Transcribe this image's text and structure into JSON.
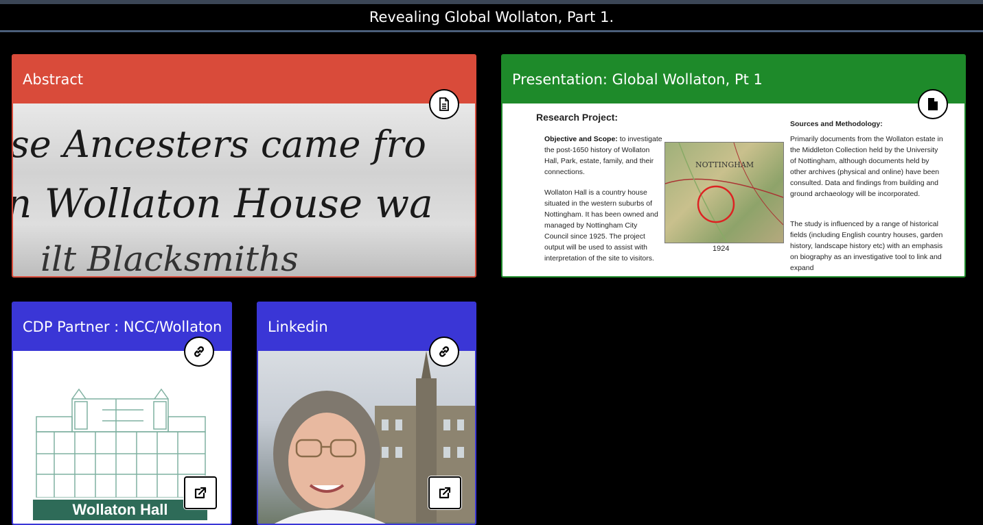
{
  "page": {
    "title": "Revealing Global Wollaton, Part 1."
  },
  "cards": {
    "abstract": {
      "title": "Abstract",
      "badge_icon": "document-lines-icon",
      "image_text": [
        "se Ancesters came fro",
        "n Wollaton House wa",
        "ilt   Blacksmiths"
      ]
    },
    "presentation": {
      "title": "Presentation: Global Wollaton, Pt 1",
      "badge_icon": "document-filled-icon",
      "slide": {
        "heading": "Research Project:",
        "objective_label": "Objective and Scope:",
        "objective_text": " to investigate the post-1650 history of Wollaton Hall, Park, estate, family, and their connections.",
        "hall_text": "Wollaton Hall is a country house situated in the western suburbs of Nottingham. It has been owned and managed by Nottingham City Council since 1925. The project output will be used to assist with interpretation of the site to visitors.",
        "map_label": "NOTTINGHAM",
        "map_year": "1924",
        "sources_heading": "Sources and Methodology:",
        "sources_text": "Primarily documents from the Wollaton estate in the Middleton Collection held by the University of Nottingham, although documents held by other archives (physical and online) have been consulted. Data and findings from building and ground archaeology will be incorporated.",
        "influence_text": "The study is influenced by a range of historical fields (including English country houses, garden history, landscape history etc) with an emphasis on biography as an investigative tool to link and expand"
      }
    },
    "cdp": {
      "title": "CDP Partner : NCC/Wollaton",
      "badge_icon": "link-icon",
      "action_icon": "external-link-icon",
      "logo_text": "Wollaton Hall"
    },
    "linkedin": {
      "title": "Linkedin",
      "badge_icon": "link-icon",
      "action_icon": "external-link-icon"
    }
  },
  "colors": {
    "abstract": "#d94b3a",
    "presentation": "#1e8a2a",
    "link_cards": "#3a36d6",
    "background": "#000000"
  }
}
